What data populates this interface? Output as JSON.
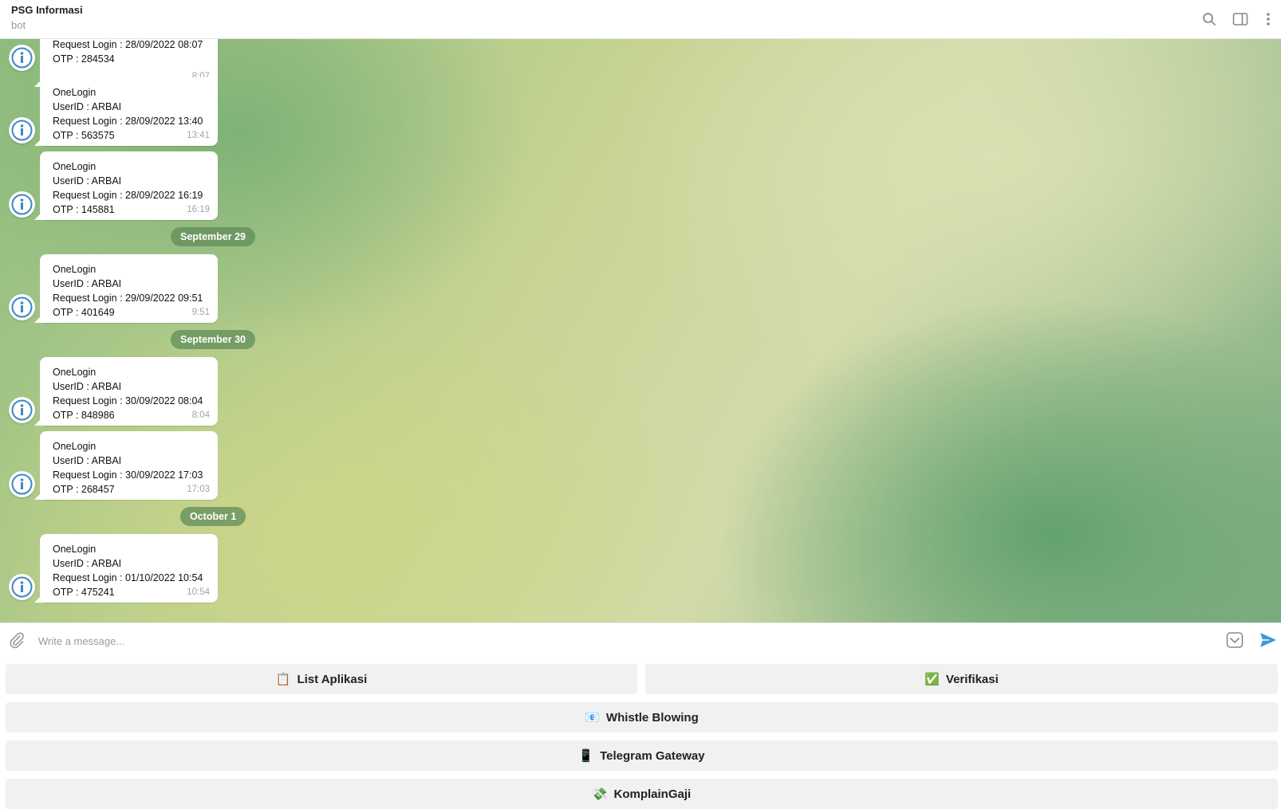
{
  "header": {
    "title": "PSG Informasi",
    "subtitle": "bot"
  },
  "messages": [
    {
      "lines": [
        "Request Login : 28/09/2022 08:07",
        "OTP : 284534"
      ],
      "time": "8:07"
    },
    {
      "lines": [
        "OneLogin",
        "UserID : ARBAI",
        "Request Login : 28/09/2022 13:40",
        "OTP : 563575"
      ],
      "time": "13:41"
    },
    {
      "lines": [
        "OneLogin",
        "UserID : ARBAI",
        "Request Login : 28/09/2022 16:19",
        "OTP : 145881"
      ],
      "time": "16:19"
    },
    {
      "lines": [
        "OneLogin",
        "UserID : ARBAI",
        "Request Login : 29/09/2022 09:51",
        "OTP : 401649"
      ],
      "time": "9:51"
    },
    {
      "lines": [
        "OneLogin",
        "UserID : ARBAI",
        "Request Login : 30/09/2022 08:04",
        "OTP : 848986"
      ],
      "time": "8:04"
    },
    {
      "lines": [
        "OneLogin",
        "UserID : ARBAI",
        "Request Login : 30/09/2022 17:03",
        "OTP : 268457"
      ],
      "time": "17:03"
    },
    {
      "lines": [
        "OneLogin",
        "UserID : ARBAI",
        "Request Login : 01/10/2022 10:54",
        "OTP : 475241"
      ],
      "time": "10:54"
    }
  ],
  "date_separators": [
    "September 29",
    "September 30",
    "October 1"
  ],
  "composer": {
    "placeholder": "Write a message..."
  },
  "keyboard": {
    "buttons": [
      {
        "icon": "📋",
        "label": "List Aplikasi"
      },
      {
        "icon": "✅",
        "label": "Verifikasi"
      },
      {
        "icon": "📧",
        "label": "Whistle Blowing"
      },
      {
        "icon": "📱",
        "label": "Telegram Gateway"
      },
      {
        "icon": "💸",
        "label": "KomplainGaji"
      }
    ]
  },
  "colors": {
    "accent": "#3a9ae0",
    "date_pill": "#6b955f",
    "avatar_icon": "#3d86c6"
  }
}
